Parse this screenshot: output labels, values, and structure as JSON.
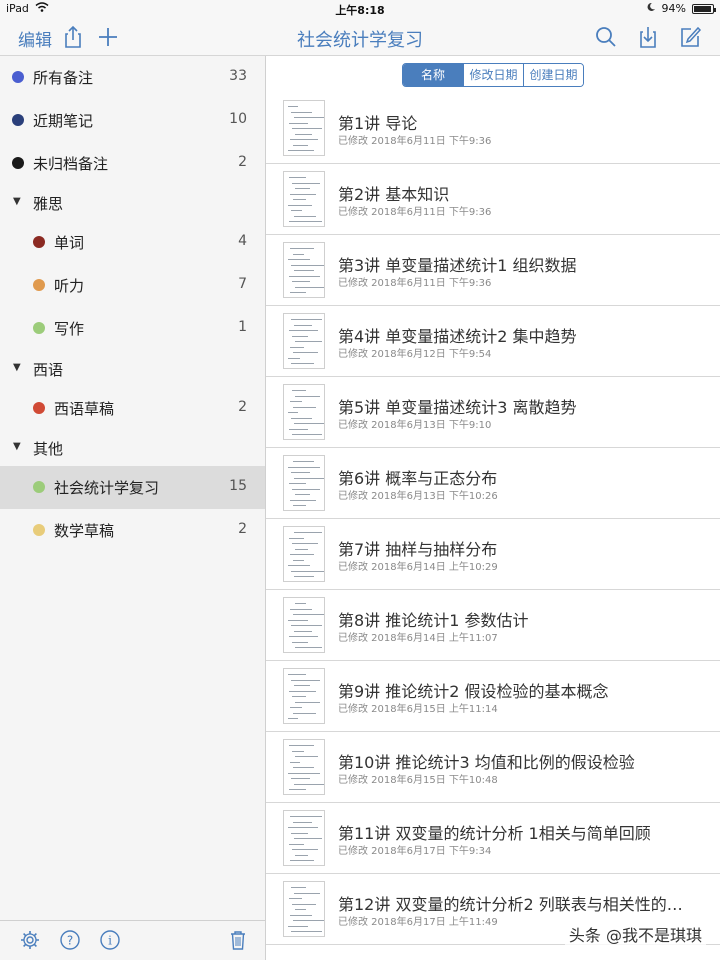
{
  "status": {
    "device": "iPad",
    "time": "上午8:18",
    "battery": "94%",
    "battery_level": 0.94
  },
  "nav": {
    "edit_label": "编辑",
    "title": "社会统计学复习",
    "accent_color": "#4a7ebd"
  },
  "sidebar": {
    "items": [
      {
        "label": "所有备注",
        "count": "33",
        "color": "#4a5ed0"
      },
      {
        "label": "近期笔记",
        "count": "10",
        "color": "#2a3f7a"
      },
      {
        "label": "未归档备注",
        "count": "2",
        "color": "#1a1a1a"
      }
    ],
    "groups": [
      {
        "label": "雅思",
        "items": [
          {
            "label": "单词",
            "count": "4",
            "color": "#8b2a22"
          },
          {
            "label": "听力",
            "count": "7",
            "color": "#e09a4e"
          },
          {
            "label": "写作",
            "count": "1",
            "color": "#9ccc7a"
          }
        ]
      },
      {
        "label": "西语",
        "items": [
          {
            "label": "西语草稿",
            "count": "2",
            "color": "#d04a35"
          }
        ]
      },
      {
        "label": "其他",
        "items": [
          {
            "label": "社会统计学复习",
            "count": "15",
            "color": "#9ccc7a",
            "selected": true
          },
          {
            "label": "数学草稿",
            "count": "2",
            "color": "#e8cc7a"
          }
        ]
      }
    ]
  },
  "sort": {
    "options": [
      "名称",
      "修改日期",
      "创建日期"
    ],
    "active": "名称"
  },
  "notes": [
    {
      "title": "第1讲 导论",
      "date": "已修改 2018年6月11日 下午9:36"
    },
    {
      "title": "第2讲 基本知识",
      "date": "已修改 2018年6月11日 下午9:36"
    },
    {
      "title": "第3讲 单变量描述统计1 组织数据",
      "date": "已修改 2018年6月11日 下午9:36"
    },
    {
      "title": "第4讲 单变量描述统计2 集中趋势",
      "date": "已修改 2018年6月12日 下午9:54"
    },
    {
      "title": "第5讲 单变量描述统计3 离散趋势",
      "date": "已修改 2018年6月13日 下午9:10"
    },
    {
      "title": "第6讲 概率与正态分布",
      "date": "已修改 2018年6月13日 下午10:26"
    },
    {
      "title": "第7讲 抽样与抽样分布",
      "date": "已修改 2018年6月14日 上午10:29"
    },
    {
      "title": "第8讲 推论统计1 参数估计",
      "date": "已修改 2018年6月14日 上午11:07"
    },
    {
      "title": "第9讲 推论统计2 假设检验的基本概念",
      "date": "已修改 2018年6月15日 上午11:14"
    },
    {
      "title": "第10讲 推论统计3 均值和比例的假设检验",
      "date": "已修改 2018年6月15日 下午10:48"
    },
    {
      "title": "第11讲 双变量的统计分析 1相关与简单回顾",
      "date": "已修改 2018年6月17日 下午9:34"
    },
    {
      "title": "第12讲 双变量的统计分析2 列联表与相关性的…",
      "date": "已修改 2018年6月17日 上午11:49"
    }
  ],
  "watermark": "头条 @我不是琪琪"
}
